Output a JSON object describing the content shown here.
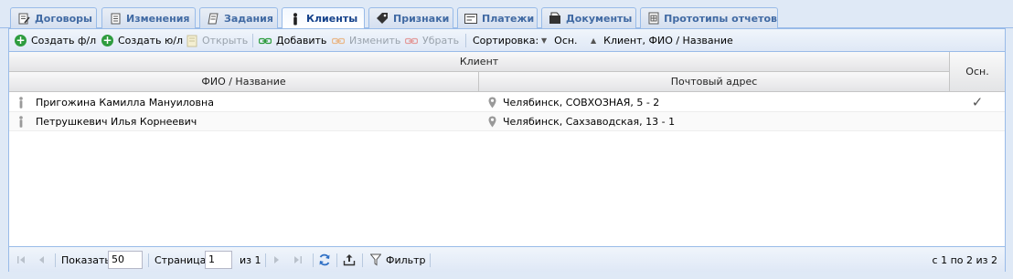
{
  "tabs": [
    {
      "label": "Договоры",
      "icon": "edit-doc-icon",
      "active": false
    },
    {
      "label": "Изменения",
      "icon": "document-icon",
      "active": false
    },
    {
      "label": "Задания",
      "icon": "task-icon",
      "active": false
    },
    {
      "label": "Клиенты",
      "icon": "person-icon",
      "active": true
    },
    {
      "label": "Признаки",
      "icon": "tag-icon",
      "active": false
    },
    {
      "label": "Платежи",
      "icon": "payment-icon",
      "active": false
    },
    {
      "label": "Документы",
      "icon": "documents-icon",
      "active": false
    },
    {
      "label": "Прототипы отчетов",
      "icon": "report-icon",
      "active": false
    }
  ],
  "toolbar": {
    "create_fl": "Создать ф/л",
    "create_ul": "Создать ю/л",
    "open": "Открыть",
    "add": "Добавить",
    "edit": "Изменить",
    "remove": "Убрать",
    "sort_label": "Сортировка:",
    "sort_osn": "Осн.",
    "sort_client": "Клиент, ФИО / Название"
  },
  "grid": {
    "group_header": "Клиент",
    "col_name": "ФИО / Название",
    "col_address": "Почтовый адрес",
    "col_osn": "Осн.",
    "rows": [
      {
        "name": "Пригожина Камилла Мануиловна",
        "address": "Челябинск, СОВХОЗНАЯ, 5 - 2",
        "osn": "✓"
      },
      {
        "name": "Петрушкевич Илья Корнеевич",
        "address": "Челябинск, Сахзаводская, 13 - 1",
        "osn": ""
      }
    ]
  },
  "pager": {
    "show_label": "Показать",
    "page_size": "50",
    "page_label": "Страница",
    "page_value": "1",
    "of_label": "из 1",
    "filter_label": "Фильтр",
    "summary": "с 1 по 2 из 2"
  },
  "colors": {
    "accent": "#15428b",
    "border": "#99bbe8",
    "green": "#2e9c3e"
  }
}
